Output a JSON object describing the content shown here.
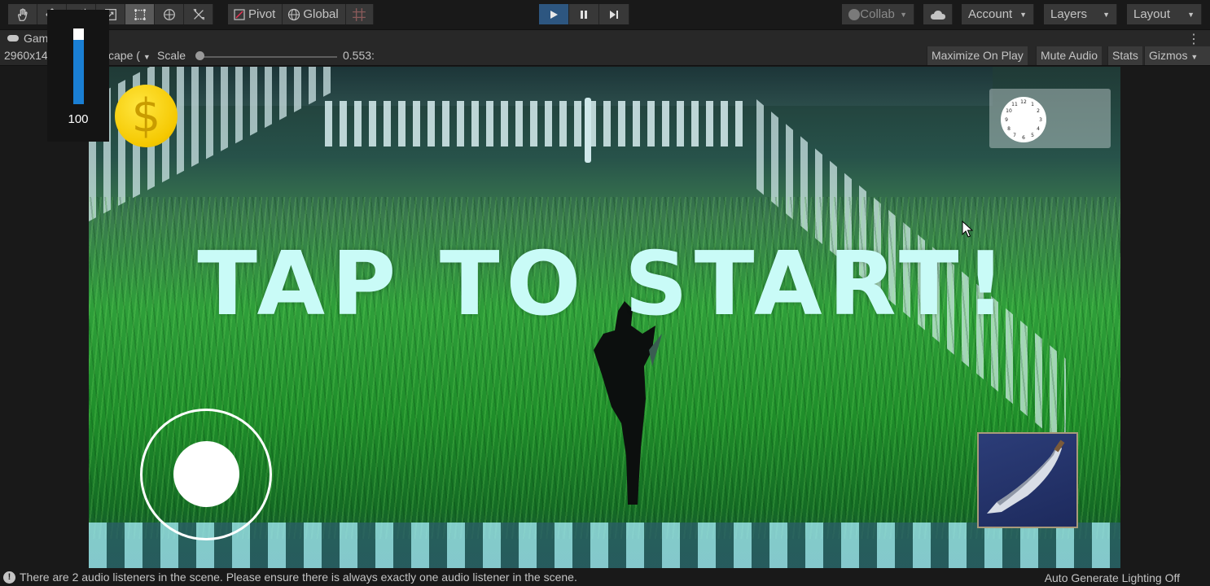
{
  "toolbar": {
    "tools": [
      {
        "icon": "hand-icon"
      },
      {
        "icon": "move-icon"
      },
      {
        "icon": "rotate-icon"
      },
      {
        "icon": "scale-icon"
      },
      {
        "icon": "rect-tool-icon"
      },
      {
        "icon": "transform-icon"
      },
      {
        "icon": "custom-tool-icon"
      }
    ],
    "pivot_label": "Pivot",
    "global_label": "Global",
    "collab_label": "Collab",
    "account_label": "Account",
    "layers_label": "Layers",
    "layout_label": "Layout"
  },
  "tab": {
    "label": "Gam"
  },
  "controls": {
    "resolution": "2960x14",
    "aspect": "cape (",
    "scale_label": "Scale",
    "scale_value": "0.553:",
    "maximize_label": "Maximize On Play",
    "mute_label": "Mute Audio",
    "stats_label": "Stats",
    "gizmos_label": "Gizmos"
  },
  "game": {
    "tap_text": "TAP TO START!",
    "coin_symbol": "$",
    "power_value": "100",
    "power_level": 0.85
  },
  "status": {
    "message": "There are 2 audio listeners in the scene. Please ensure there is always exactly one audio listener in the scene.",
    "lighting": "Auto Generate Lighting Off"
  },
  "colors": {
    "accent_play": "#2d5680",
    "coin": "#f5c800",
    "power_fill": "#1a7fd4",
    "tap_text": "#c9fbf7"
  }
}
